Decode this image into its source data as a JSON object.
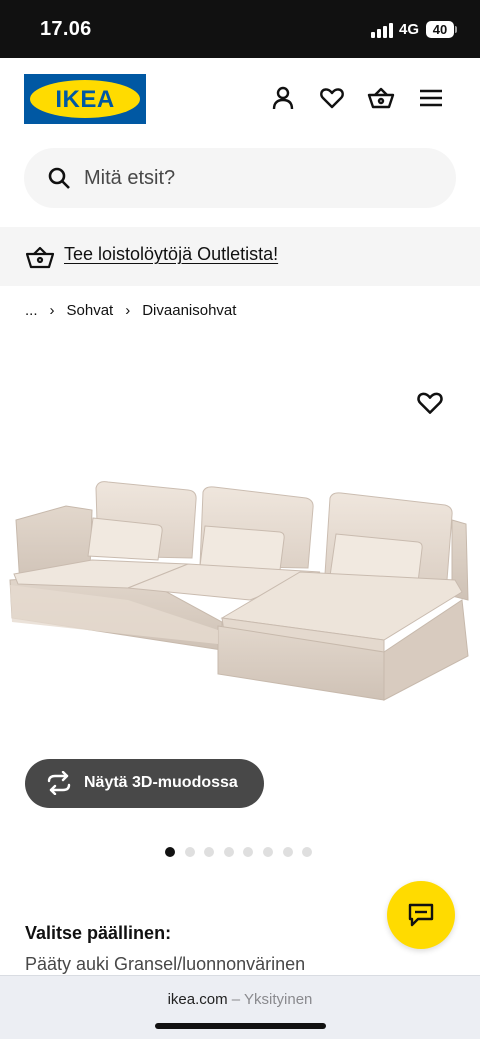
{
  "status_bar": {
    "time": "17.06",
    "network": "4G",
    "battery": "40"
  },
  "header": {
    "logo_text": "IKEA",
    "icons": [
      "account-icon",
      "favourites-icon",
      "shopping-bag-icon",
      "menu-icon"
    ]
  },
  "search": {
    "placeholder": "Mitä etsit?"
  },
  "banner": {
    "link_text": "Tee loistolöytöjä Outletista!"
  },
  "breadcrumb": {
    "items": [
      "...",
      "Sohvat",
      "Divaanisohvat"
    ]
  },
  "product": {
    "view_3d_label": "Näytä 3D-muodossa",
    "gallery": {
      "total": 8,
      "active": 1
    },
    "cover_title": "Valitse päällinen:",
    "cover_value": "Pääty auki Gransel/luonnonvärinen"
  },
  "browser": {
    "domain": "ikea.com",
    "mode": "– Yksityinen"
  },
  "colors": {
    "ikea_blue": "#0058a3",
    "ikea_yellow": "#ffdb00",
    "button_dark": "#484848"
  }
}
